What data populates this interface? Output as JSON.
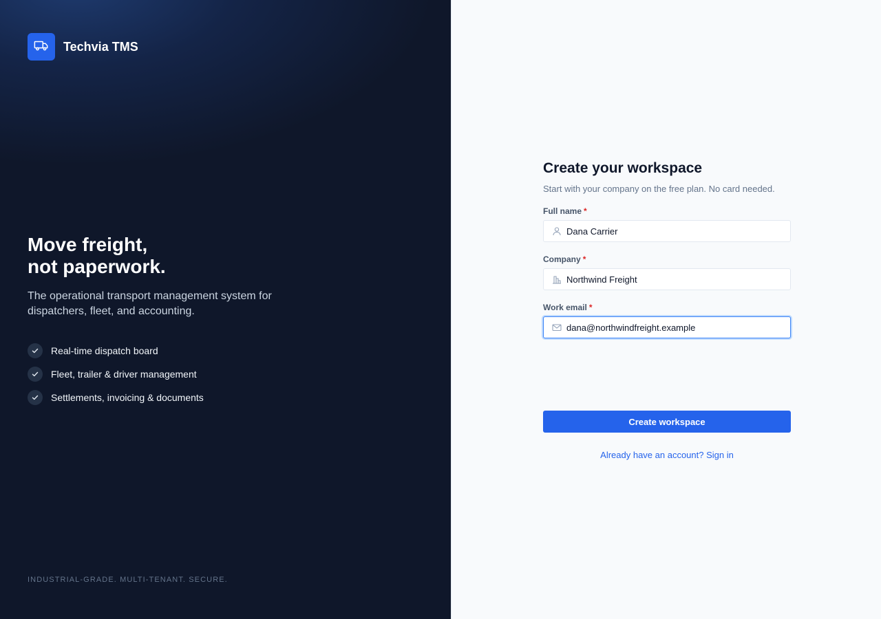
{
  "brand": {
    "name": "Techvia TMS",
    "logo_icon": "truck-icon",
    "accent_color": "#2563eb"
  },
  "hero": {
    "title_line1": "Move freight,",
    "title_line2": "not paperwork.",
    "subtitle": "The operational transport management system for dispatchers, fleet, and accounting.",
    "features": [
      {
        "icon": "check-icon",
        "label": "Real-time dispatch board"
      },
      {
        "icon": "check-icon",
        "label": "Fleet, trailer & driver management"
      },
      {
        "icon": "check-icon",
        "label": "Settlements, invoicing & documents"
      }
    ],
    "tagline": "INDUSTRIAL-GRADE. MULTI-TENANT. SECURE."
  },
  "form": {
    "title": "Create your workspace",
    "subtitle": "Start with your company on the free plan. No card needed.",
    "required_marker": "*",
    "fields": {
      "full_name": {
        "label": "Full name",
        "value": "Dana Carrier",
        "icon": "user-icon"
      },
      "company": {
        "label": "Company",
        "value": "Northwind Freight",
        "icon": "building-icon"
      },
      "work_email": {
        "label": "Work email",
        "value": "dana@northwindfreight.example",
        "icon": "mail-icon",
        "focused": true
      }
    },
    "submit_label": "Create workspace",
    "signin_link": "Already have an account? Sign in"
  }
}
